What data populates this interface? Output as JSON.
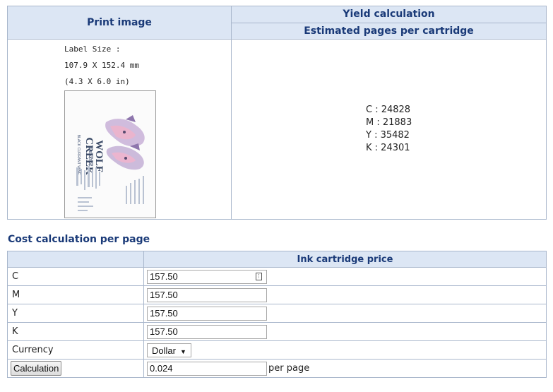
{
  "top_table": {
    "print_image_header": "Print image",
    "yield_header": "Yield calculation",
    "estimated_header": "Estimated pages per cartridge",
    "label_size_line1": "Label Size :",
    "label_size_line2": "107.9 X 152.4 mm",
    "label_size_line3": "(4.3 X 6.0 in)",
    "yield": {
      "c": "C : 24828",
      "m": "M : 21883",
      "y": "Y : 35482",
      "k": "K : 24301"
    }
  },
  "label_art": {
    "brand_line1": "WOLF",
    "brand_line2": "CREEK",
    "sub1": "VINEYARDS",
    "sub2": "BLACK CURRANT WINE"
  },
  "cost": {
    "section_title": "Cost calculation per page",
    "price_header": "Ink cartridge price",
    "rows": [
      {
        "label": "C",
        "value": "157.50"
      },
      {
        "label": "M",
        "value": "157.50"
      },
      {
        "label": "Y",
        "value": "157.50"
      },
      {
        "label": "K",
        "value": "157.50"
      }
    ],
    "currency_label": "Currency",
    "currency_value": "Dollar",
    "calc_button": "Calculation",
    "result_value": "0.024",
    "result_unit": "per page"
  }
}
